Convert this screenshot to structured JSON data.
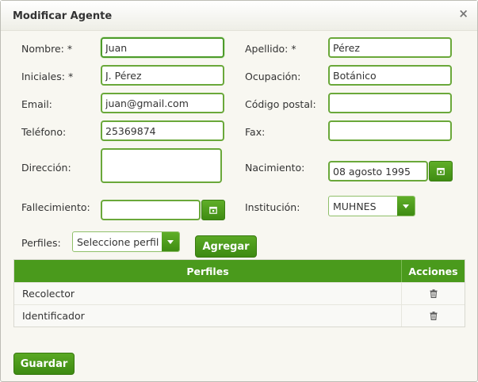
{
  "dialog": {
    "title": "Modificar Agente",
    "close_glyph": "×"
  },
  "form": {
    "nombre": {
      "label": "Nombre: *",
      "value": "Juan"
    },
    "apellido": {
      "label": "Apellido: *",
      "value": "Pérez"
    },
    "iniciales": {
      "label": "Iniciales: *",
      "value": "J. Pérez"
    },
    "ocupacion": {
      "label": "Ocupación:",
      "value": "Botánico"
    },
    "email": {
      "label": "Email:",
      "value": "juan@gmail.com"
    },
    "codigo_postal": {
      "label": "Código postal:",
      "value": ""
    },
    "telefono": {
      "label": "Teléfono:",
      "value": "25369874"
    },
    "fax": {
      "label": "Fax:",
      "value": ""
    },
    "direccion": {
      "label": "Dirección:",
      "value": ""
    },
    "nacimiento": {
      "label": "Nacimiento:",
      "value": "08 agosto 1995"
    },
    "fallecimiento": {
      "label": "Fallecimiento:",
      "value": ""
    },
    "institucion": {
      "label": "Institución:",
      "value": "MUHNES"
    },
    "perfiles": {
      "label": "Perfiles:",
      "value": "Seleccione perfil"
    }
  },
  "buttons": {
    "agregar": "Agregar",
    "guardar": "Guardar"
  },
  "table": {
    "headers": [
      "Perfiles",
      "Acciones"
    ],
    "rows": [
      {
        "perfil": "Recolector",
        "action_icon": "trash-icon"
      },
      {
        "perfil": "Identificador",
        "action_icon": "trash-icon"
      }
    ]
  },
  "colors": {
    "accent": "#4a9a1c",
    "input_border": "#6aa83a",
    "dialog_bg": "#f8f7f1"
  }
}
